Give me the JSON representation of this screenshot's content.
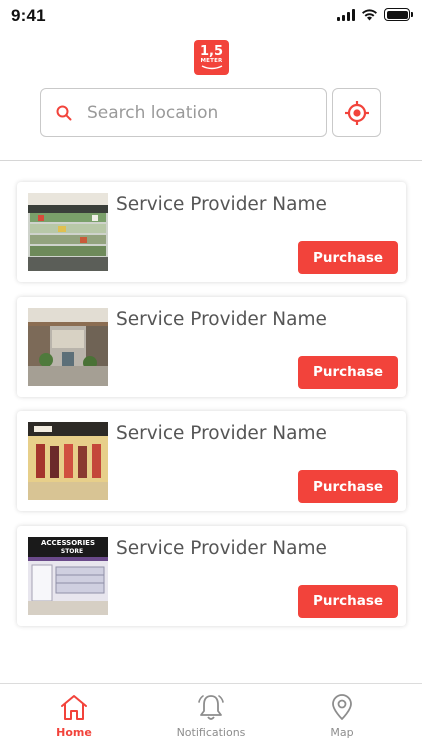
{
  "status_bar": {
    "time": "9:41"
  },
  "logo": {
    "main": "1,5",
    "sub": "METER"
  },
  "search": {
    "placeholder": "Search location"
  },
  "providers": [
    {
      "name": "Service Provider Name",
      "button": "Purchase",
      "image": "supermarket-shelves"
    },
    {
      "name": "Service Provider Name",
      "button": "Purchase",
      "image": "shopping-mall"
    },
    {
      "name": "Service Provider Name",
      "button": "Purchase",
      "image": "clothing-store"
    },
    {
      "name": "Service Provider Name",
      "button": "Purchase",
      "image": "accessories-store"
    }
  ],
  "store_sign": {
    "line1": "ACCESSORIES",
    "line2": "STORE"
  },
  "tabs": [
    {
      "label": "Home",
      "icon": "home-icon",
      "active": true
    },
    {
      "label": "Notifications",
      "icon": "bell-icon",
      "active": false
    },
    {
      "label": "Map",
      "icon": "map-pin-icon",
      "active": false
    }
  ],
  "colors": {
    "accent": "#f2433b",
    "text": "#555555",
    "inactive": "#8d8d8d"
  }
}
